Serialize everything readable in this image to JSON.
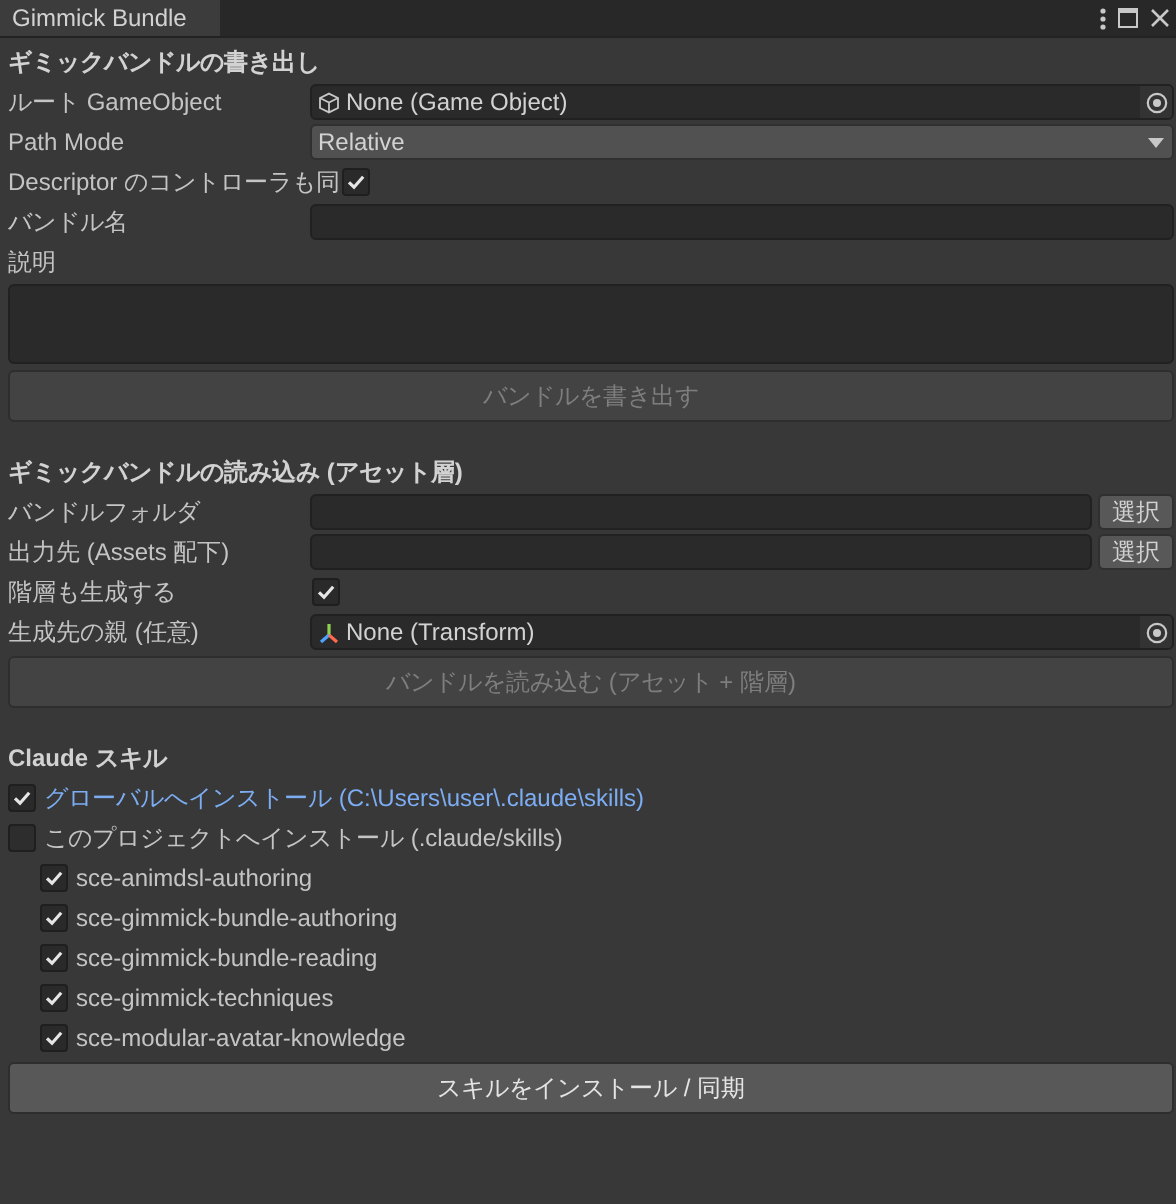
{
  "window": {
    "tab": "Gimmick Bundle"
  },
  "sections": [
    {
      "title": "ギミックバンドルの書き出し",
      "fields": [
        {
          "kind": "gameobject",
          "label": "ルート GameObject",
          "value": "None (Game Object)"
        },
        {
          "kind": "dropdown",
          "label": "Path Mode",
          "value": "Relative"
        },
        {
          "kind": "checkbox",
          "label": "Descriptor のコントローラも同",
          "checked": true
        },
        {
          "kind": "text",
          "label": "バンドル名"
        },
        {
          "kind": "textarea",
          "label": "説明"
        }
      ],
      "button": {
        "label": "バンドルを書き出す",
        "disabled": true
      }
    },
    {
      "title": "ギミックバンドルの読み込み (アセット層)",
      "fields": [
        {
          "kind": "path",
          "label": "バンドルフォルダ",
          "button": "選択"
        },
        {
          "kind": "path",
          "label": "出力先 (Assets 配下)",
          "button": "選択"
        },
        {
          "kind": "checkbox",
          "label": "階層も生成する",
          "checked": true
        },
        {
          "kind": "transform",
          "label": "生成先の親 (任意)",
          "value": "None (Transform)"
        }
      ],
      "button": {
        "label": "バンドルを読み込む (アセット + 階層)",
        "disabled": true
      }
    },
    {
      "title": "Claude スキル",
      "options": [
        {
          "label": "グローバルへインストール (C:\\Users\\user\\.claude\\skills)",
          "checked": true
        },
        {
          "label": "このプロジェクトへインストール (.claude/skills)",
          "checked": false
        }
      ],
      "skills": [
        {
          "label": "sce-animdsl-authoring",
          "checked": true
        },
        {
          "label": "sce-gimmick-bundle-authoring",
          "checked": true
        },
        {
          "label": "sce-gimmick-bundle-reading",
          "checked": true
        },
        {
          "label": "sce-gimmick-techniques",
          "checked": true
        },
        {
          "label": "sce-modular-avatar-knowledge",
          "checked": true
        }
      ],
      "button": {
        "label": "スキルをインストール / 同期",
        "disabled": false
      }
    }
  ]
}
